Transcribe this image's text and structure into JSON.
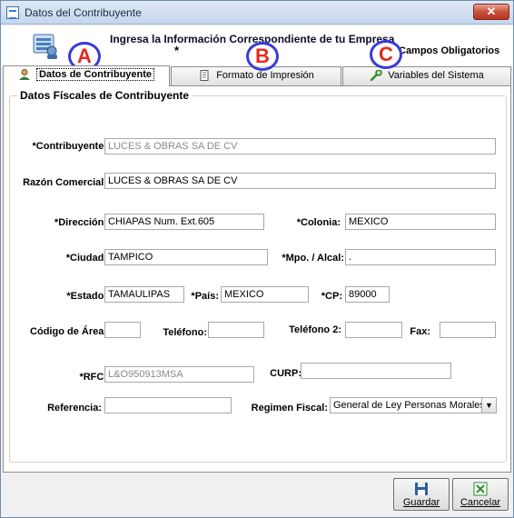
{
  "window": {
    "title": "Datos del Contribuyente",
    "close_label": "✕"
  },
  "header": {
    "instruction": "Ingresa la Información Correspondiente de tu Empresa",
    "required_star": "*",
    "required_note": "Campos Obligatorios"
  },
  "markers": {
    "a": "A",
    "b": "B",
    "c": "C"
  },
  "tabs": [
    {
      "label": "Datos de Contribuyente",
      "icon": "user-icon",
      "active": true
    },
    {
      "label": "Formato de Impresión",
      "icon": "document-icon",
      "active": false
    },
    {
      "label": "Variables del Sistema",
      "icon": "wrench-icon",
      "active": false
    }
  ],
  "group": {
    "title": "Datos Físcales de Contribuyente"
  },
  "form": {
    "contribuyente": {
      "label": "*Contribuyente:",
      "value": "LUCES & OBRAS SA DE CV"
    },
    "razon_comercial": {
      "label": "Razón Comercial:",
      "value": "LUCES & OBRAS SA DE CV"
    },
    "direccion": {
      "label": "*Dirección:",
      "value": "CHIAPAS Num. Ext.605"
    },
    "colonia": {
      "label": "*Colonia:",
      "value": "MEXICO"
    },
    "ciudad": {
      "label": "*Ciudad:",
      "value": "TAMPICO"
    },
    "municipio": {
      "label": "*Mpo. / Alcal:",
      "value": "."
    },
    "estado": {
      "label": "*Estado:",
      "value": "TAMAULIPAS"
    },
    "pais": {
      "label": "*País:",
      "value": "MEXICO"
    },
    "cp": {
      "label": "*CP:",
      "value": "89000"
    },
    "codigo_area": {
      "label": "Código de Área:",
      "value": ""
    },
    "telefono": {
      "label": "Teléfono:",
      "value": ""
    },
    "telefono2": {
      "label": "Teléfono 2:",
      "value": ""
    },
    "fax": {
      "label": "Fax:",
      "value": ""
    },
    "rfc": {
      "label": "*RFC:",
      "value": "L&O950913MSA"
    },
    "curp": {
      "label": "CURP:",
      "value": ""
    },
    "referencia": {
      "label": "Referencia:",
      "value": ""
    },
    "regimen_fiscal": {
      "label": "Regimen Fiscal:",
      "value": "General de Ley Personas Morales"
    }
  },
  "buttons": {
    "save": "Guardar",
    "cancel": "Cancelar"
  },
  "colors": {
    "marker_ring": "#3a3ad8",
    "marker_letter": "#e22a1a",
    "close_button": "#c9503a"
  }
}
